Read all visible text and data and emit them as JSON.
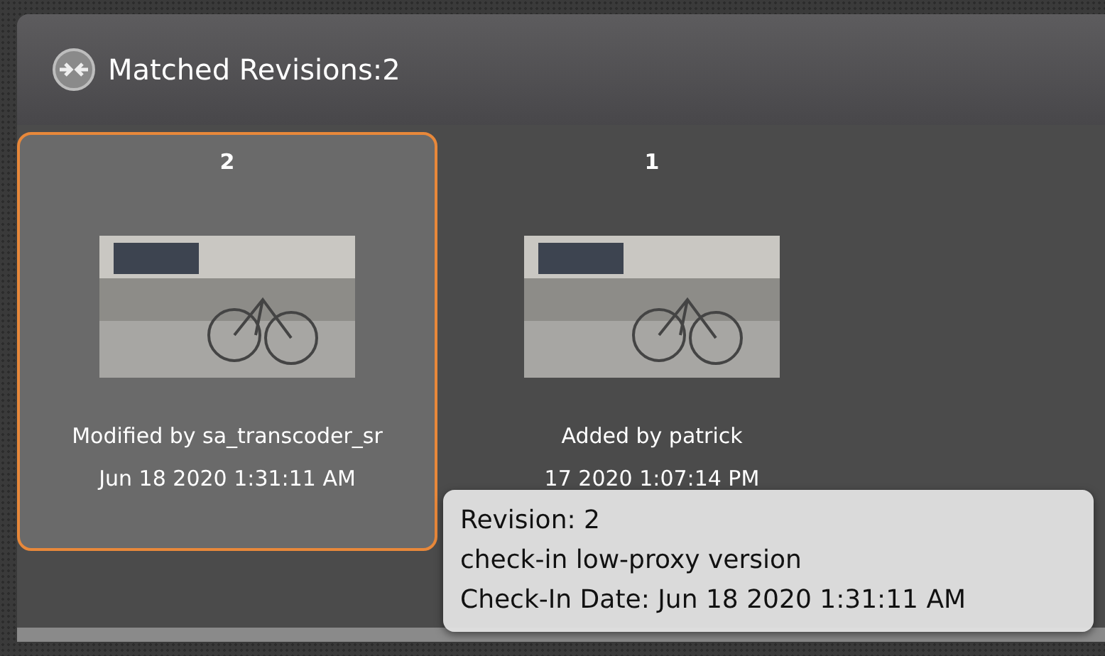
{
  "header": {
    "title": "Matched Revisions:2"
  },
  "revisions": [
    {
      "number": "2",
      "selected": true,
      "caption": "Modified by sa_transcoder_sr",
      "date": "Jun 18 2020 1:31:11 AM"
    },
    {
      "number": "1",
      "selected": false,
      "caption": "Added by patrick",
      "date": "17 2020 1:07:14 PM"
    }
  ],
  "tooltip": {
    "lines": [
      "Revision: 2",
      "check-in low-proxy version",
      "Check-In Date: Jun 18 2020 1:31:11 AM"
    ]
  }
}
